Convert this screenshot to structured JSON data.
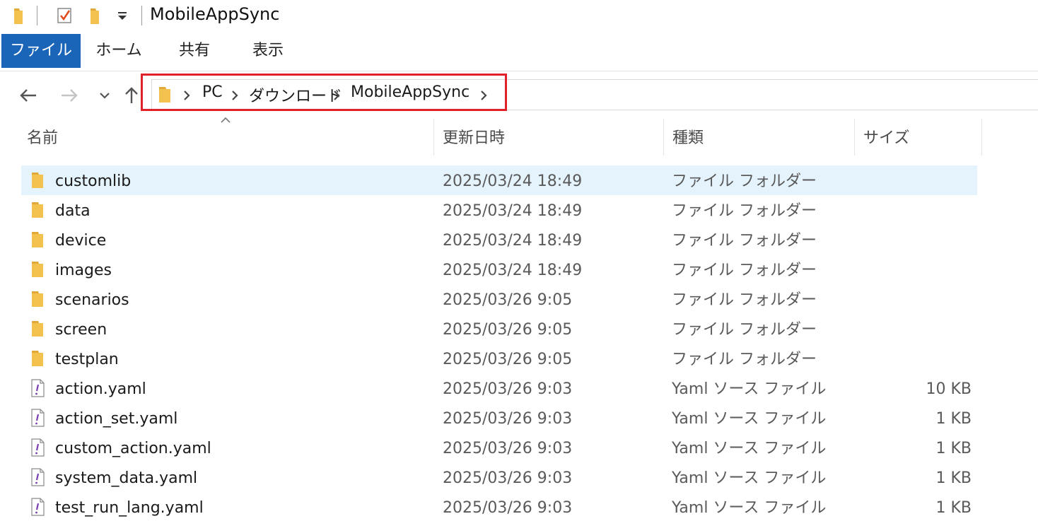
{
  "window": {
    "title": "MobileAppSync"
  },
  "ribbon": {
    "tabs": [
      "ファイル",
      "ホーム",
      "共有",
      "表示"
    ]
  },
  "address": {
    "crumbs": [
      "PC",
      "ダウンロード",
      "MobileAppSync"
    ]
  },
  "columns": {
    "name": "名前",
    "date": "更新日時",
    "type": "種類",
    "size": "サイズ"
  },
  "files": [
    {
      "name": "customlib",
      "date": "2025/03/24 18:49",
      "type": "ファイル フォルダー",
      "size": "",
      "icon": "folder-icon",
      "selected": true
    },
    {
      "name": "data",
      "date": "2025/03/24 18:49",
      "type": "ファイル フォルダー",
      "size": "",
      "icon": "folder-icon"
    },
    {
      "name": "device",
      "date": "2025/03/24 18:49",
      "type": "ファイル フォルダー",
      "size": "",
      "icon": "folder-icon"
    },
    {
      "name": "images",
      "date": "2025/03/24 18:49",
      "type": "ファイル フォルダー",
      "size": "",
      "icon": "folder-icon"
    },
    {
      "name": "scenarios",
      "date": "2025/03/26 9:05",
      "type": "ファイル フォルダー",
      "size": "",
      "icon": "folder-icon"
    },
    {
      "name": "screen",
      "date": "2025/03/26 9:05",
      "type": "ファイル フォルダー",
      "size": "",
      "icon": "folder-icon"
    },
    {
      "name": "testplan",
      "date": "2025/03/26 9:05",
      "type": "ファイル フォルダー",
      "size": "",
      "icon": "folder-icon"
    },
    {
      "name": "action.yaml",
      "date": "2025/03/26 9:03",
      "type": "Yaml ソース ファイル",
      "size": "10 KB",
      "icon": "yaml-file-icon"
    },
    {
      "name": "action_set.yaml",
      "date": "2025/03/26 9:03",
      "type": "Yaml ソース ファイル",
      "size": "1 KB",
      "icon": "yaml-file-icon"
    },
    {
      "name": "custom_action.yaml",
      "date": "2025/03/26 9:03",
      "type": "Yaml ソース ファイル",
      "size": "1 KB",
      "icon": "yaml-file-icon"
    },
    {
      "name": "system_data.yaml",
      "date": "2025/03/26 9:03",
      "type": "Yaml ソース ファイル",
      "size": "1 KB",
      "icon": "yaml-file-icon"
    },
    {
      "name": "test_run_lang.yaml",
      "date": "2025/03/26 9:03",
      "type": "Yaml ソース ファイル",
      "size": "1 KB",
      "icon": "yaml-file-icon"
    }
  ],
  "colors": {
    "accent": "#1a65b8",
    "selection": "#e5f3fd",
    "highlight": "#e0202a",
    "folder": "#f2c14e"
  }
}
